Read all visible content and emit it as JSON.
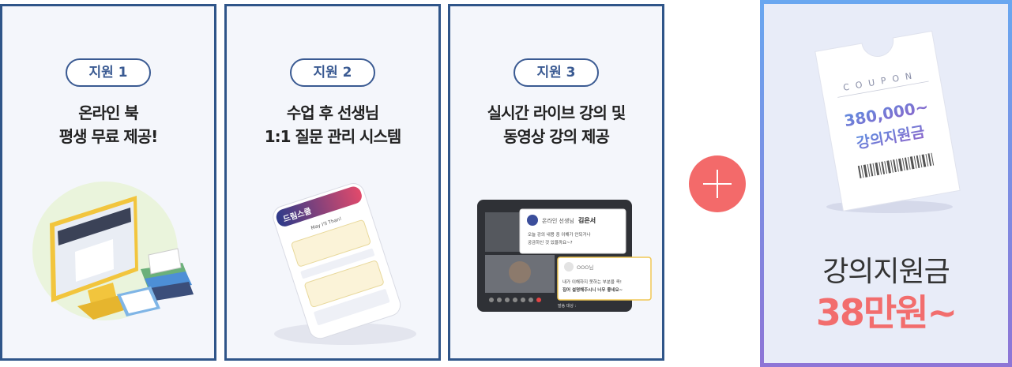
{
  "cards": [
    {
      "badge": "지원 1",
      "line1": "온라인 북",
      "line2": "평생 무료 제공!"
    },
    {
      "badge": "지원 2",
      "line1": "수업 후 선생님",
      "line2": "1:1 질문 관리 시스템"
    },
    {
      "badge": "지원 3",
      "line1": "실시간 라이브 강의 및",
      "line2": "동영상 강의 제공"
    }
  ],
  "phone": {
    "app_name": "드림스쿨",
    "greeting": "May I'll Than!"
  },
  "live_chat": {
    "teacher_label": "온라인 선생님",
    "teacher_name": "김은서",
    "teacher_msg1": "오늘 강의 내용 중 이해가 안되거나",
    "teacher_msg2": "궁금하신 것 있을까요~?",
    "student_name": "OOO님",
    "student_msg1": "내가 이해하지 못하는 부분을 콕!",
    "student_msg2": "집어 설명해주시니 너무 좋네요~",
    "footer": "발송 대상 :"
  },
  "coupon": {
    "heading": "COUPON",
    "amount": "380,000~",
    "name": "강의지원금"
  },
  "summary": {
    "label": "강의지원금",
    "amount": "38만원~"
  },
  "colors": {
    "accent_blue": "#2f5589",
    "accent_red": "#f26d6d",
    "coupon_purple": "#7a6bd0"
  }
}
